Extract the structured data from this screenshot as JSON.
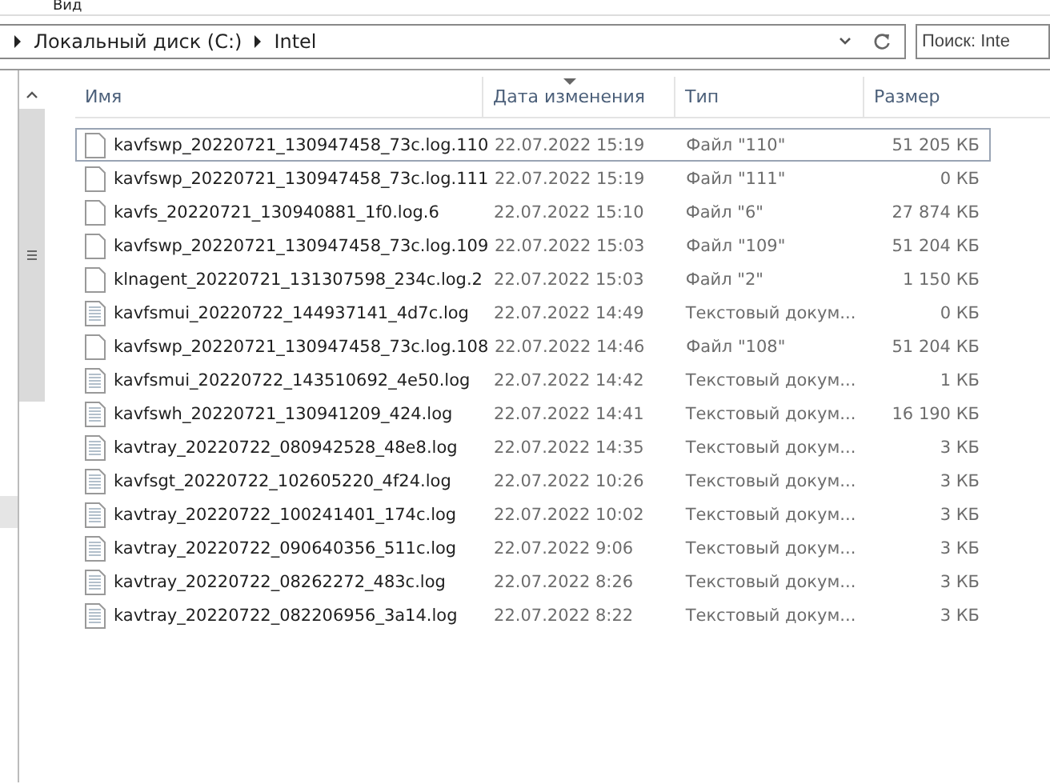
{
  "menu": {
    "items": [
      "Вид"
    ]
  },
  "address_bar": {
    "path": [
      "Локальный диск (C:)",
      "Intel"
    ]
  },
  "search": {
    "placeholder": "Поиск: Inte"
  },
  "table": {
    "columns": [
      {
        "label": "Имя",
        "sorted": false
      },
      {
        "label": "Дата изменения",
        "sorted": true
      },
      {
        "label": "Тип",
        "sorted": false
      },
      {
        "label": "Размер",
        "sorted": false
      }
    ],
    "rows": [
      {
        "kind": "file",
        "name": "kavfswp_20220721_130947458_73c.log.110",
        "date": "22.07.2022 15:19",
        "type": "Файл \"110\"",
        "size": "51 205 КБ",
        "focused": true
      },
      {
        "kind": "file",
        "name": "kavfswp_20220721_130947458_73c.log.111",
        "date": "22.07.2022 15:19",
        "type": "Файл \"111\"",
        "size": "0 КБ",
        "focused": false
      },
      {
        "kind": "file",
        "name": "kavfs_20220721_130940881_1f0.log.6",
        "date": "22.07.2022 15:10",
        "type": "Файл \"6\"",
        "size": "27 874 КБ",
        "focused": false
      },
      {
        "kind": "file",
        "name": "kavfswp_20220721_130947458_73c.log.109",
        "date": "22.07.2022 15:03",
        "type": "Файл \"109\"",
        "size": "51 204 КБ",
        "focused": false
      },
      {
        "kind": "file",
        "name": "klnagent_20220721_131307598_234c.log.2",
        "date": "22.07.2022 15:03",
        "type": "Файл \"2\"",
        "size": "1 150 КБ",
        "focused": false
      },
      {
        "kind": "text",
        "name": "kavfsmui_20220722_144937141_4d7c.log",
        "date": "22.07.2022 14:49",
        "type": "Текстовый докум...",
        "size": "0 КБ",
        "focused": false
      },
      {
        "kind": "file",
        "name": "kavfswp_20220721_130947458_73c.log.108",
        "date": "22.07.2022 14:46",
        "type": "Файл \"108\"",
        "size": "51 204 КБ",
        "focused": false
      },
      {
        "kind": "text",
        "name": "kavfsmui_20220722_143510692_4e50.log",
        "date": "22.07.2022 14:42",
        "type": "Текстовый докум...",
        "size": "1 КБ",
        "focused": false
      },
      {
        "kind": "text",
        "name": "kavfswh_20220721_130941209_424.log",
        "date": "22.07.2022 14:41",
        "type": "Текстовый докум...",
        "size": "16 190 КБ",
        "focused": false
      },
      {
        "kind": "text",
        "name": "kavtray_20220722_080942528_48e8.log",
        "date": "22.07.2022 14:35",
        "type": "Текстовый докум...",
        "size": "3 КБ",
        "focused": false
      },
      {
        "kind": "text",
        "name": "kavfsgt_20220722_102605220_4f24.log",
        "date": "22.07.2022 10:26",
        "type": "Текстовый докум...",
        "size": "3 КБ",
        "focused": false
      },
      {
        "kind": "text",
        "name": "kavtray_20220722_100241401_174c.log",
        "date": "22.07.2022 10:02",
        "type": "Текстовый докум...",
        "size": "3 КБ",
        "focused": false
      },
      {
        "kind": "text",
        "name": "kavtray_20220722_090640356_511c.log",
        "date": "22.07.2022 9:06",
        "type": "Текстовый докум...",
        "size": "3 КБ",
        "focused": false
      },
      {
        "kind": "text",
        "name": "kavtray_20220722_08262272_483c.log",
        "date": "22.07.2022 8:26",
        "type": "Текстовый докум...",
        "size": "3 КБ",
        "focused": false
      },
      {
        "kind": "text",
        "name": "kavtray_20220722_082206956_3a14.log",
        "date": "22.07.2022 8:22",
        "type": "Текстовый докум...",
        "size": "3 КБ",
        "focused": false
      }
    ]
  }
}
